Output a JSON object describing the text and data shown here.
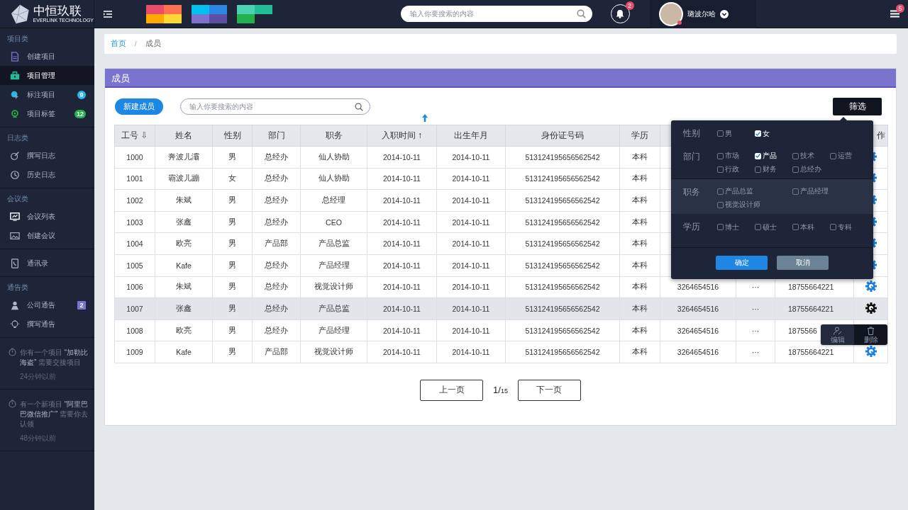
{
  "topbar": {
    "logo": {
      "name": "中恒玖联",
      "tagline": "EVERLINK TECHNOLOGY"
    },
    "theme_swatches": [
      {
        "swatches": [
          {
            "color": "#e84c6a"
          },
          {
            "color": "#fe7150"
          },
          {
            "color": "#ffa800"
          },
          {
            "color": "#fdd835"
          }
        ]
      },
      {
        "swatches": [
          {
            "color": "#00c0ef"
          },
          {
            "color": "#2b87e3"
          },
          {
            "color": "#7b73cd"
          },
          {
            "color": "#5c4ea1"
          }
        ]
      },
      {
        "swatches": [
          {
            "color": "#4bd0b0"
          },
          {
            "color": "#1fbe99"
          },
          {
            "color": "#22b14c"
          }
        ]
      }
    ],
    "search": {
      "placeholder": "输入你要搜索的内容"
    },
    "notifications_badge": "2",
    "user": {
      "name": "璐波尔哈",
      "online": true
    },
    "menu_badge": "5"
  },
  "sidebar": {
    "sections": [
      {
        "title": "项目类",
        "items": [
          {
            "label": "创建项目",
            "selected": false
          },
          {
            "label": "项目管理",
            "selected": true
          },
          {
            "label": "标注项目",
            "selected": false,
            "badge": "9",
            "color": "#29b6e8"
          },
          {
            "label": "项目标签",
            "selected": false,
            "badge": "12",
            "color": "#22b14c"
          }
        ]
      },
      {
        "title": "日志类",
        "items": [
          {
            "label": "撰写日志",
            "selected": false
          },
          {
            "label": "历史日志",
            "selected": false
          }
        ]
      },
      {
        "title": "会议类",
        "items": [
          {
            "label": "会议列表",
            "selected": false
          },
          {
            "label": "创建会议",
            "selected": false
          }
        ]
      },
      {
        "items": [
          {
            "label": "通讯录",
            "selected": false
          }
        ]
      },
      {
        "title": "通告类",
        "items": [
          {
            "label": "公司通告",
            "selected": false,
            "badge": "2",
            "color": "#7b73cd"
          },
          {
            "label": "撰写通告",
            "selected": false
          }
        ]
      }
    ],
    "notices": [
      {
        "text": "你有一个项目 **“加勒比海盗”** 需要交接项目",
        "time": "24分钟以前"
      },
      {
        "text": "有一个新项目 **“阿里巴巴微信推广”** 需要你去认领",
        "time": "48分钟以前"
      }
    ]
  },
  "breadcrumb": {
    "separator": "/",
    "items": [
      {
        "label": "首页",
        "link": true
      },
      {
        "label": "成员",
        "link": false
      }
    ]
  },
  "panel": {
    "title": "成员",
    "new_button": "新建成员",
    "search": {
      "placeholder": "输入你要搜索的内容"
    },
    "filter_button": "筛选",
    "table": {
      "columns": [
        {
          "label": "工号",
          "sort": "⇩"
        },
        {
          "label": "姓名"
        },
        {
          "label": "性别"
        },
        {
          "label": "部门"
        },
        {
          "label": "职务"
        },
        {
          "label": "入职时间",
          "sort": "↑"
        },
        {
          "label": "出生年月"
        },
        {
          "label": "身份证号码"
        },
        {
          "label": "学历"
        },
        {
          "label": "作"
        }
      ],
      "rows": [
        {
          "selected": false,
          "cells": [
            "1000",
            "奔波儿灞",
            "男",
            "总经办",
            "仙人协助",
            "2014-10-11",
            "2014-10-11",
            "513124195656562542",
            "本科"
          ]
        },
        {
          "selected": false,
          "cells": [
            "1001",
            "霸波儿蹦",
            "女",
            "总经办",
            "仙人协助",
            "2014-10-11",
            "2014-10-11",
            "513124195656562542",
            "本科"
          ]
        },
        {
          "selected": false,
          "cells": [
            "1002",
            "朱斌",
            "男",
            "总经办",
            "总经理",
            "2014-10-11",
            "2014-10-11",
            "513124195656562542",
            "本科"
          ]
        },
        {
          "selected": false,
          "cells": [
            "1003",
            "张鑫",
            "男",
            "总经办",
            "CEO",
            "2014-10-11",
            "2014-10-11",
            "513124195656562542",
            "本科"
          ]
        },
        {
          "selected": false,
          "cells": [
            "1004",
            "欧亮",
            "男",
            "产品部",
            "产品总监",
            "2014-10-11",
            "2014-10-11",
            "513124195656562542",
            "本科"
          ]
        },
        {
          "selected": false,
          "cells": [
            "1005",
            "Kafe",
            "男",
            "总经办",
            "产品经理",
            "2014-10-11",
            "2014-10-11",
            "513124195656562542",
            "本科"
          ]
        },
        {
          "selected": false,
          "cells": [
            "1006",
            "朱斌",
            "男",
            "总经办",
            "视觉设计师",
            "2014-10-11",
            "2014-10-11",
            "513124195656562542",
            "本科",
            "3264654516",
            "···",
            "18755664221"
          ]
        },
        {
          "selected": true,
          "cells": [
            "1007",
            "张鑫",
            "男",
            "总经办",
            "产品总监",
            "2014-10-11",
            "2014-10-11",
            "513124195656562542",
            "本科",
            "3264654516",
            "···",
            "18755664221"
          ]
        },
        {
          "selected": false,
          "cells": [
            "1008",
            "欧亮",
            "男",
            "总经办",
            "产品经理",
            "2014-10-11",
            "2014-10-11",
            "513124195656562542",
            "本科",
            "3264654516",
            "···",
            "1875566"
          ]
        },
        {
          "selected": false,
          "cells": [
            "1009",
            "Kafe",
            "男",
            "产品部",
            "视觉设计师",
            "2014-10-11",
            "2014-10-11",
            "513124195656562542",
            "本科",
            "3264654516",
            "···",
            "18755664221"
          ]
        }
      ]
    },
    "row_actions": [
      {
        "label": "编辑",
        "selected": false
      },
      {
        "label": "删除",
        "selected": true
      }
    ],
    "pagination": {
      "prev": "上一页",
      "page": "1/",
      "total": "15",
      "next": "下一页"
    }
  },
  "filter": {
    "groups": [
      {
        "label": "性别",
        "highlighted": false,
        "options": [
          {
            "label": "男",
            "checked": false
          },
          {
            "label": "女",
            "checked": true
          }
        ]
      },
      {
        "label": "部门",
        "highlighted": false,
        "options": [
          {
            "label": "市场",
            "checked": false
          },
          {
            "label": "产品",
            "checked": true
          },
          {
            "label": "技术",
            "checked": false
          },
          {
            "label": "运营",
            "checked": false
          },
          {
            "label": "行政",
            "checked": false
          },
          {
            "label": "财务",
            "checked": false
          },
          {
            "label": "总经办",
            "checked": false
          }
        ]
      },
      {
        "label": "职务",
        "highlighted": true,
        "wide": true,
        "options": [
          {
            "label": "产品总监",
            "checked": false
          },
          {
            "label": "产品经理",
            "checked": false
          },
          {
            "label": "视觉设计师",
            "checked": false
          }
        ]
      },
      {
        "label": "学历",
        "highlighted": false,
        "options": [
          {
            "label": "博士",
            "checked": false
          },
          {
            "label": "硕士",
            "checked": false
          },
          {
            "label": "本科",
            "checked": false
          },
          {
            "label": "专科",
            "checked": false
          }
        ]
      }
    ],
    "confirm": "确定",
    "cancel": "取消"
  }
}
